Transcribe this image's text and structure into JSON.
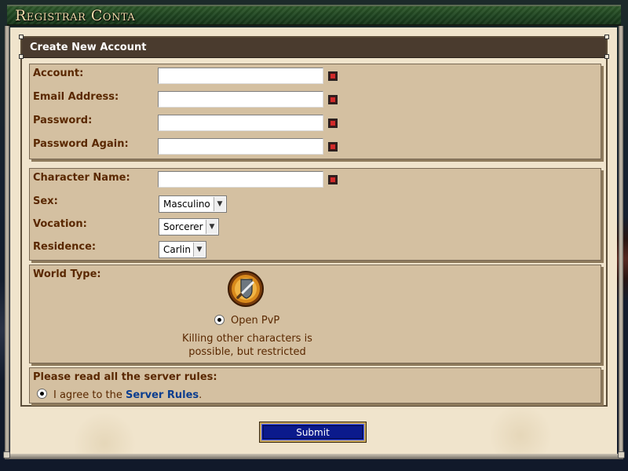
{
  "window": {
    "title": "Registrar Conta"
  },
  "form": {
    "header": "Create New Account",
    "account_section": {
      "account_label": "Account:",
      "account_value": "",
      "email_label": "Email Address:",
      "email_value": "",
      "password_label": "Password:",
      "password_value": "",
      "password_again_label": "Password Again:",
      "password_again_value": ""
    },
    "character_section": {
      "character_name_label": "Character Name:",
      "character_name_value": "",
      "sex_label": "Sex:",
      "sex_selected": "Masculino",
      "vocation_label": "Vocation:",
      "vocation_selected": "Sorcerer",
      "residence_label": "Residence:",
      "residence_selected": "Carlin"
    },
    "world_section": {
      "label": "World Type:",
      "option_label": "Open PvP",
      "option_selected": true,
      "option_description_line1": "Killing other characters is",
      "option_description_line2": "possible, but restricted",
      "icon": "sword-shield-icon"
    },
    "rules_section": {
      "heading": "Please read all the server rules:",
      "agree_prefix": "I agree to the",
      "rules_link": "Server Rules",
      "agree_suffix": ".",
      "agreed": true
    },
    "submit_label": "Submit"
  },
  "colors": {
    "label_text": "#5a2800",
    "panel_bg": "#d4c0a1",
    "header_bg": "#4a3b2e",
    "link": "#0a3d8f",
    "submit_bg": "#0b1a8c",
    "required_marker": "#d22a2a"
  }
}
